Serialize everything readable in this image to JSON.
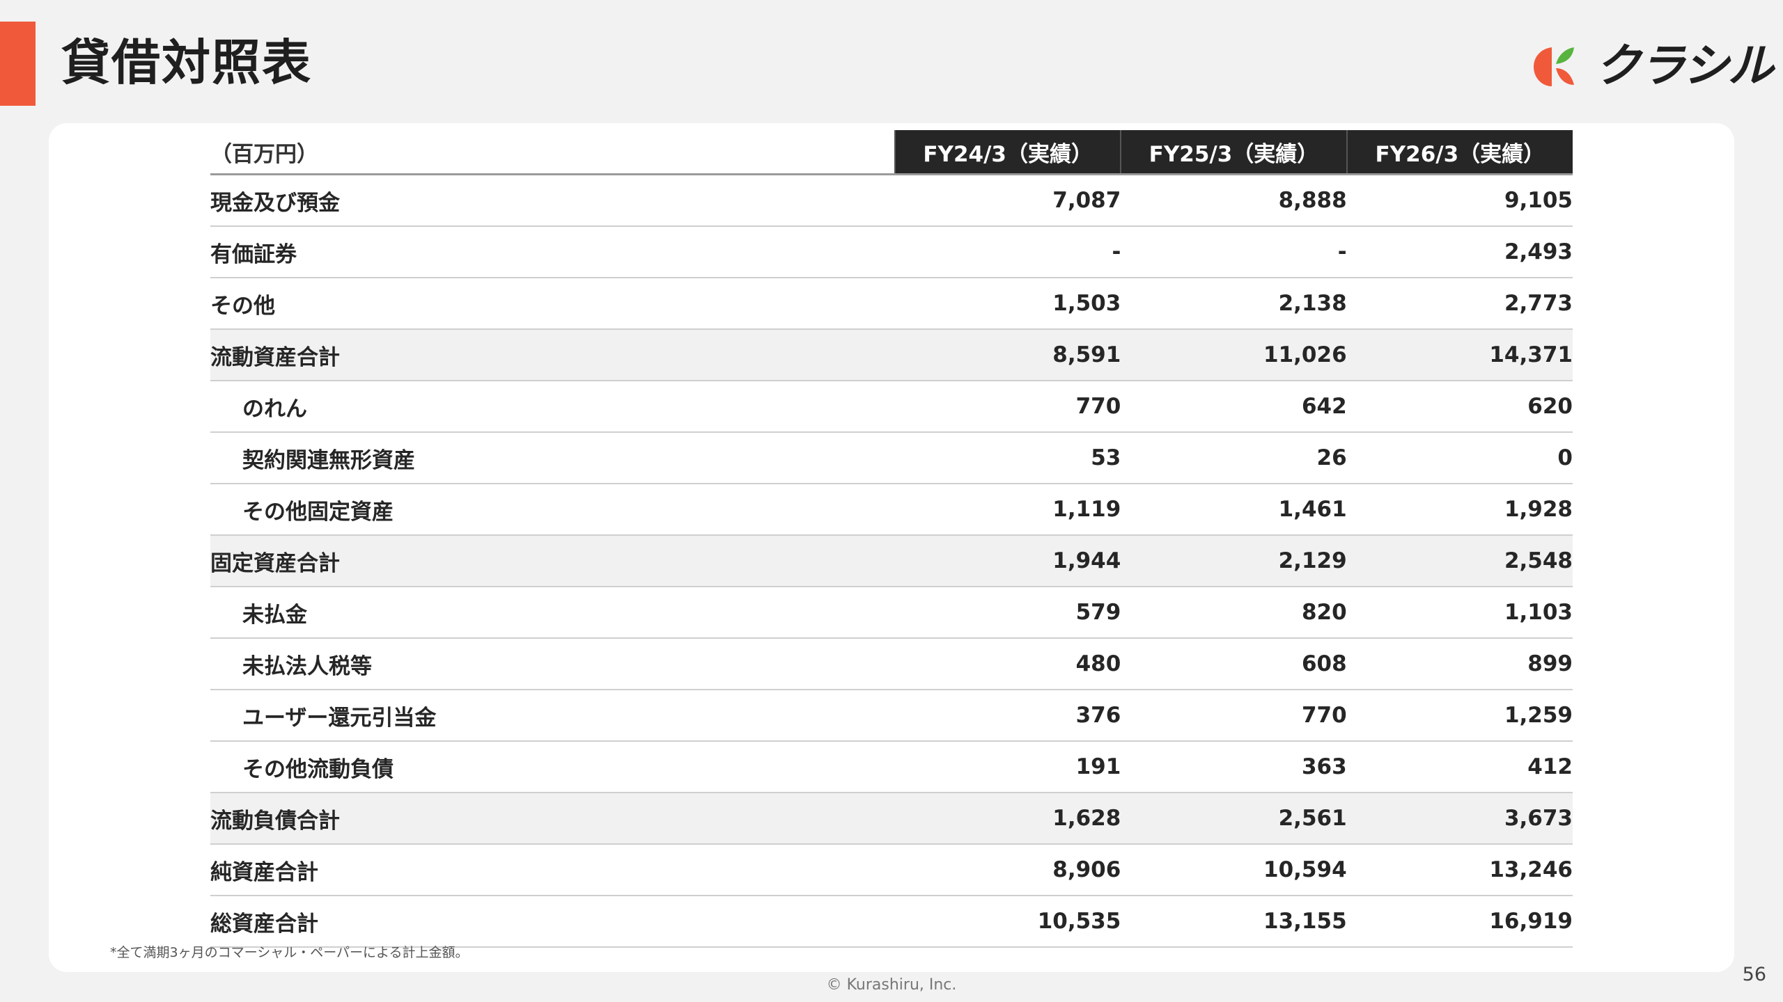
{
  "header": {
    "title": "貸借対照表",
    "brand_name": "クラシル",
    "brand_colors": {
      "accent": "#f05a3a",
      "leaf_green": "#58b43f",
      "leaf_orange": "#f05a3a"
    }
  },
  "table": {
    "unit_label": "（百万円）",
    "columns": [
      "FY24/3（実績）",
      "FY25/3（実績）",
      "FY26/3（実績）"
    ],
    "rows": [
      {
        "label": "現金及び預金",
        "values": [
          "7,087",
          "8,888",
          "9,105"
        ]
      },
      {
        "label": "有価証券",
        "values": [
          "-",
          "-",
          "2,493"
        ]
      },
      {
        "label": "その他",
        "values": [
          "1,503",
          "2,138",
          "2,773"
        ]
      },
      {
        "label": "流動資産合計",
        "values": [
          "8,591",
          "11,026",
          "14,371"
        ]
      },
      {
        "label": "のれん",
        "values": [
          "770",
          "642",
          "620"
        ]
      },
      {
        "label": "契約関連無形資産",
        "values": [
          "53",
          "26",
          "0"
        ]
      },
      {
        "label": "その他固定資産",
        "values": [
          "1,119",
          "1,461",
          "1,928"
        ]
      },
      {
        "label": "固定資産合計",
        "values": [
          "1,944",
          "2,129",
          "2,548"
        ]
      },
      {
        "label": "未払金",
        "values": [
          "579",
          "820",
          "1,103"
        ]
      },
      {
        "label": "未払法人税等",
        "values": [
          "480",
          "608",
          "899"
        ]
      },
      {
        "label": "ユーザー還元引当金",
        "values": [
          "376",
          "770",
          "1,259"
        ]
      },
      {
        "label": "その他流動負債",
        "values": [
          "191",
          "363",
          "412"
        ]
      },
      {
        "label": "流動負債合計",
        "values": [
          "1,628",
          "2,561",
          "3,673"
        ]
      },
      {
        "label": "純資産合計",
        "values": [
          "8,906",
          "10,594",
          "13,246"
        ]
      },
      {
        "label": "総資産合計",
        "values": [
          "10,535",
          "13,155",
          "16,919"
        ]
      }
    ]
  },
  "footer": {
    "footnote": "*全て満期3ヶ月のコマーシャル・ペーパーによる計上金額。",
    "copyright": "© Kurashiru, Inc.",
    "page_number": "56"
  }
}
